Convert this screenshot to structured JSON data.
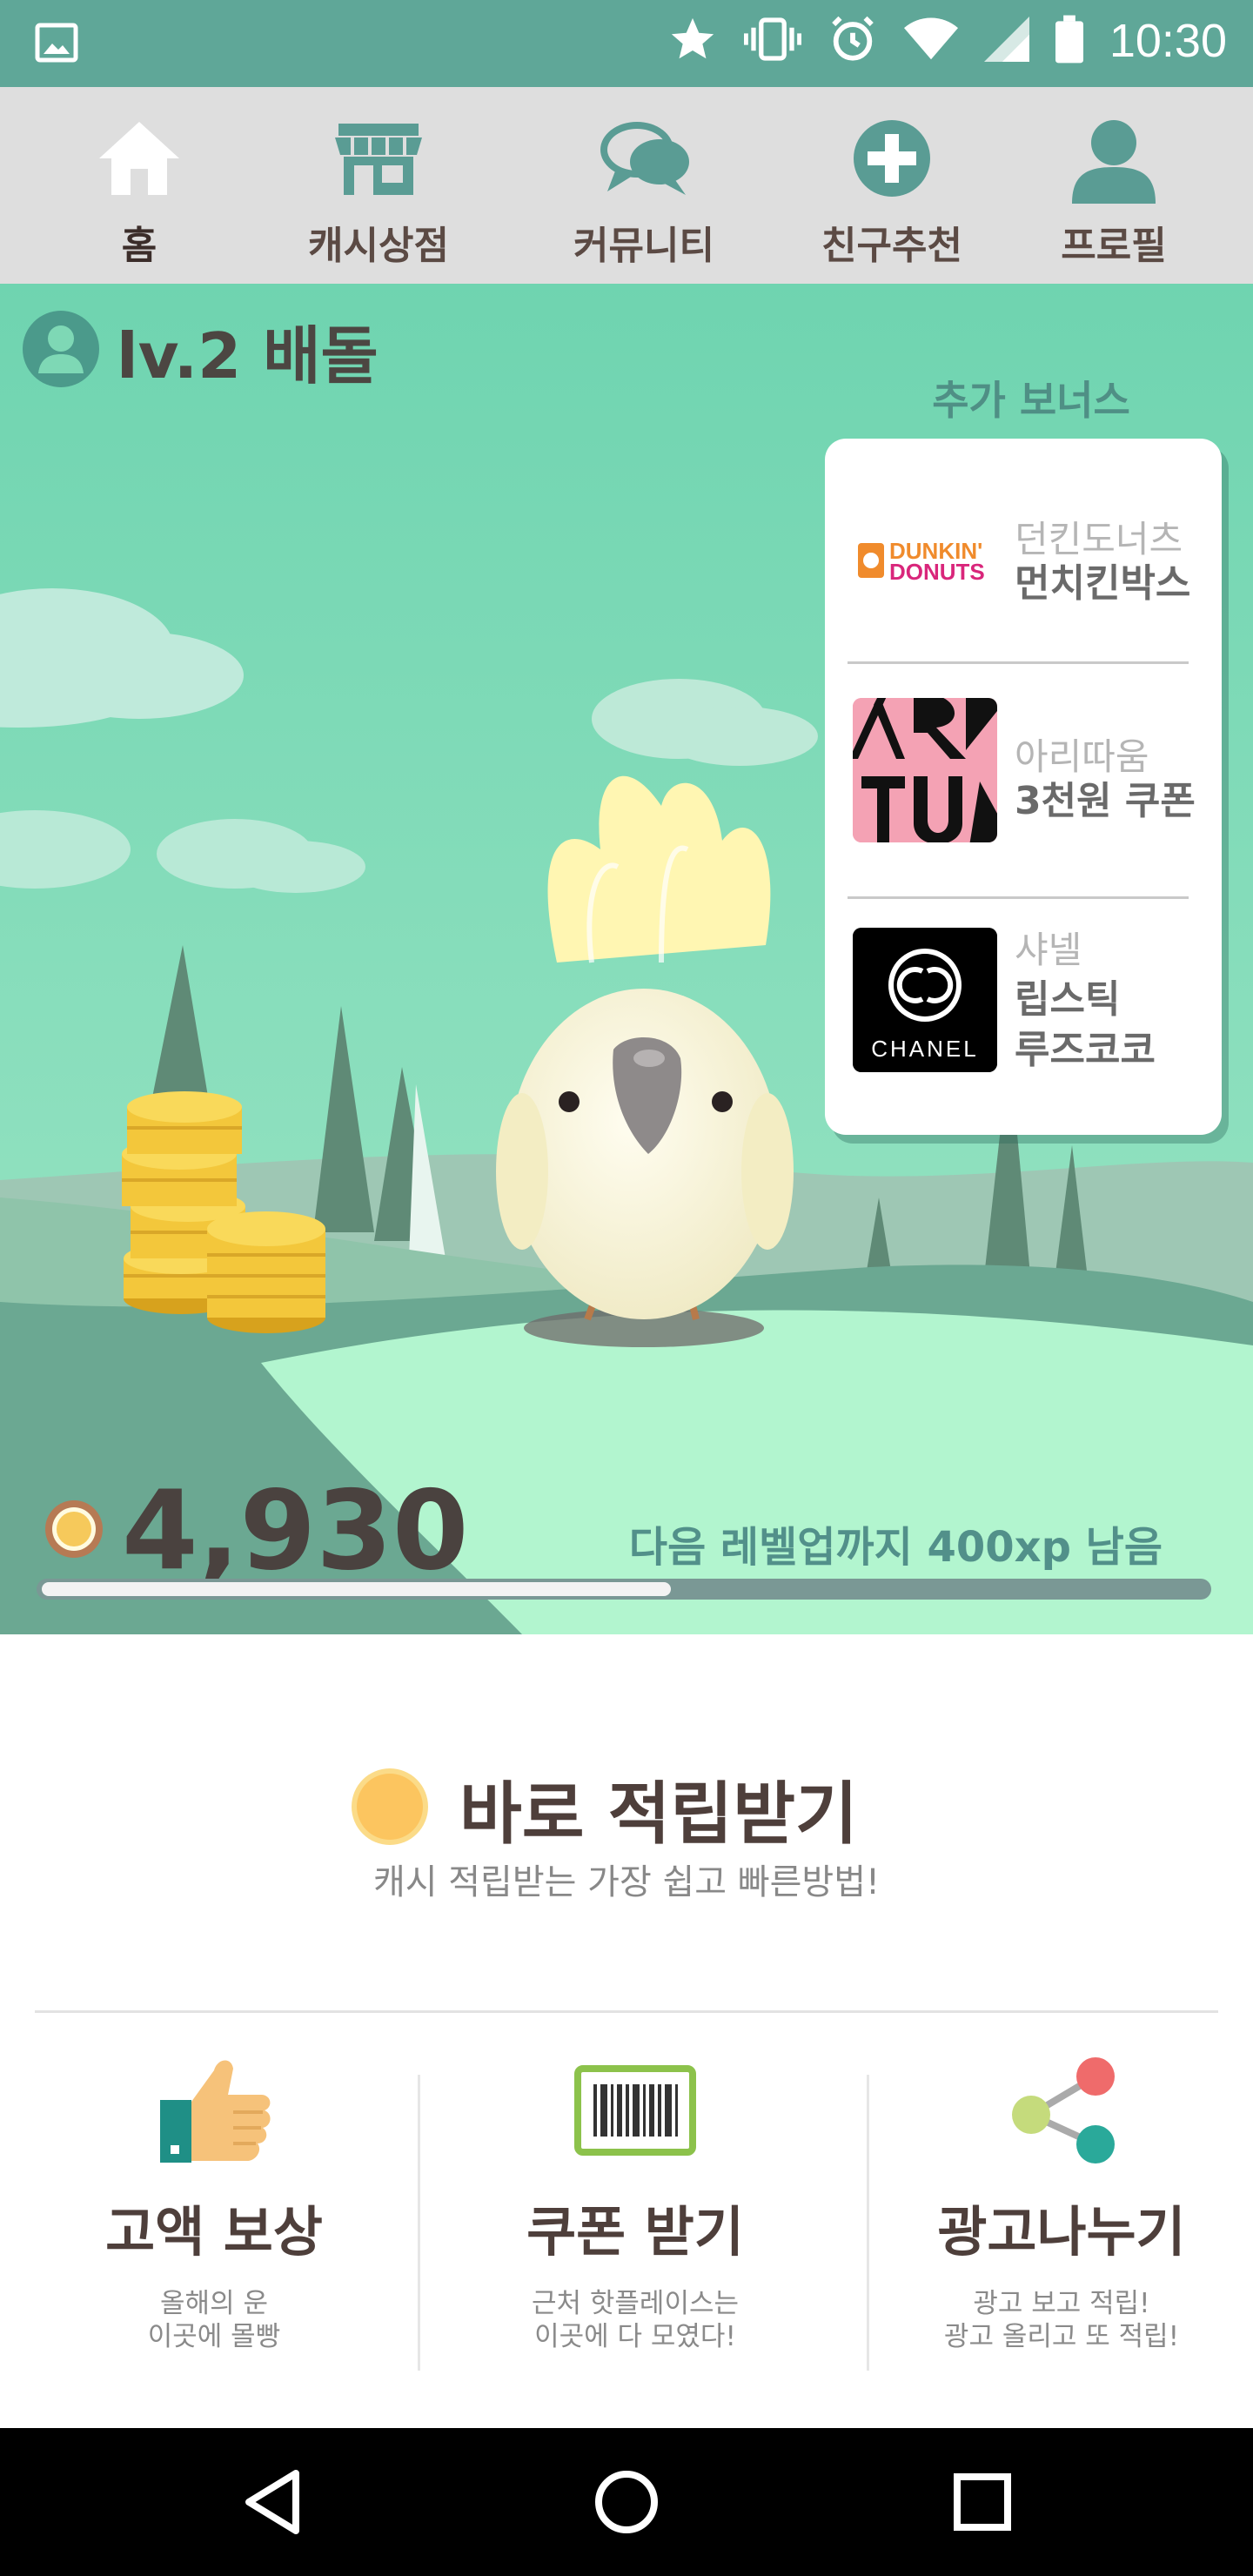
{
  "status_bar": {
    "time": "10:30",
    "icons": [
      "image-icon",
      "star-icon",
      "vibrate-icon",
      "alarm-icon",
      "wifi-icon",
      "signal-icon",
      "battery-icon"
    ]
  },
  "tabs": [
    {
      "label": "홈",
      "icon": "home-icon",
      "active": true
    },
    {
      "label": "캐시상점",
      "icon": "store-icon",
      "active": false
    },
    {
      "label": "커뮤니티",
      "icon": "chat-icon",
      "active": false
    },
    {
      "label": "친구추천",
      "icon": "plus-circle-icon",
      "active": false
    },
    {
      "label": "프로필",
      "icon": "profile-icon",
      "active": false
    }
  ],
  "hero": {
    "level": "lv.2 배돌",
    "bonus_title": "추가 보너스",
    "bonus_items": [
      {
        "brand": "던킨도너츠",
        "product": "먼치킨박스",
        "logo_text": "DUNKIN' DONUTS"
      },
      {
        "brand": "아리따움",
        "product": "3천원 쿠폰",
        "logo_text": "ARITAUM"
      },
      {
        "brand": "샤넬",
        "product_line1": "립스틱",
        "product_line2": "루즈코코",
        "logo_text": "CHANEL"
      }
    ],
    "coins": "4,930",
    "xp_text": "다음 레벨업까지 400xp 남음",
    "xp_progress": 0.54
  },
  "earn": {
    "title": "바로 적립받기",
    "subtitle": "캐시 적립받는 가장 쉽고 빠른방법!"
  },
  "features": [
    {
      "title": "고액 보상",
      "desc1": "올해의 운",
      "desc2": "이곳에 몰빵",
      "icon": "thumbs-up-icon"
    },
    {
      "title": "쿠폰 받기",
      "desc1": "근처 핫플레이스는",
      "desc2": "이곳에 다 모였다!",
      "icon": "barcode-icon"
    },
    {
      "title": "광고나누기",
      "desc1": "광고 보고 적립!",
      "desc2": "광고 올리고 또 적립!",
      "icon": "share-icon"
    }
  ],
  "colors": {
    "status_bar": "#5fa798",
    "tab_bar": "#dedede",
    "sky": "#7ed8b5",
    "accent_teal": "#5a9c94",
    "coin_gold": "#f6c95b"
  }
}
